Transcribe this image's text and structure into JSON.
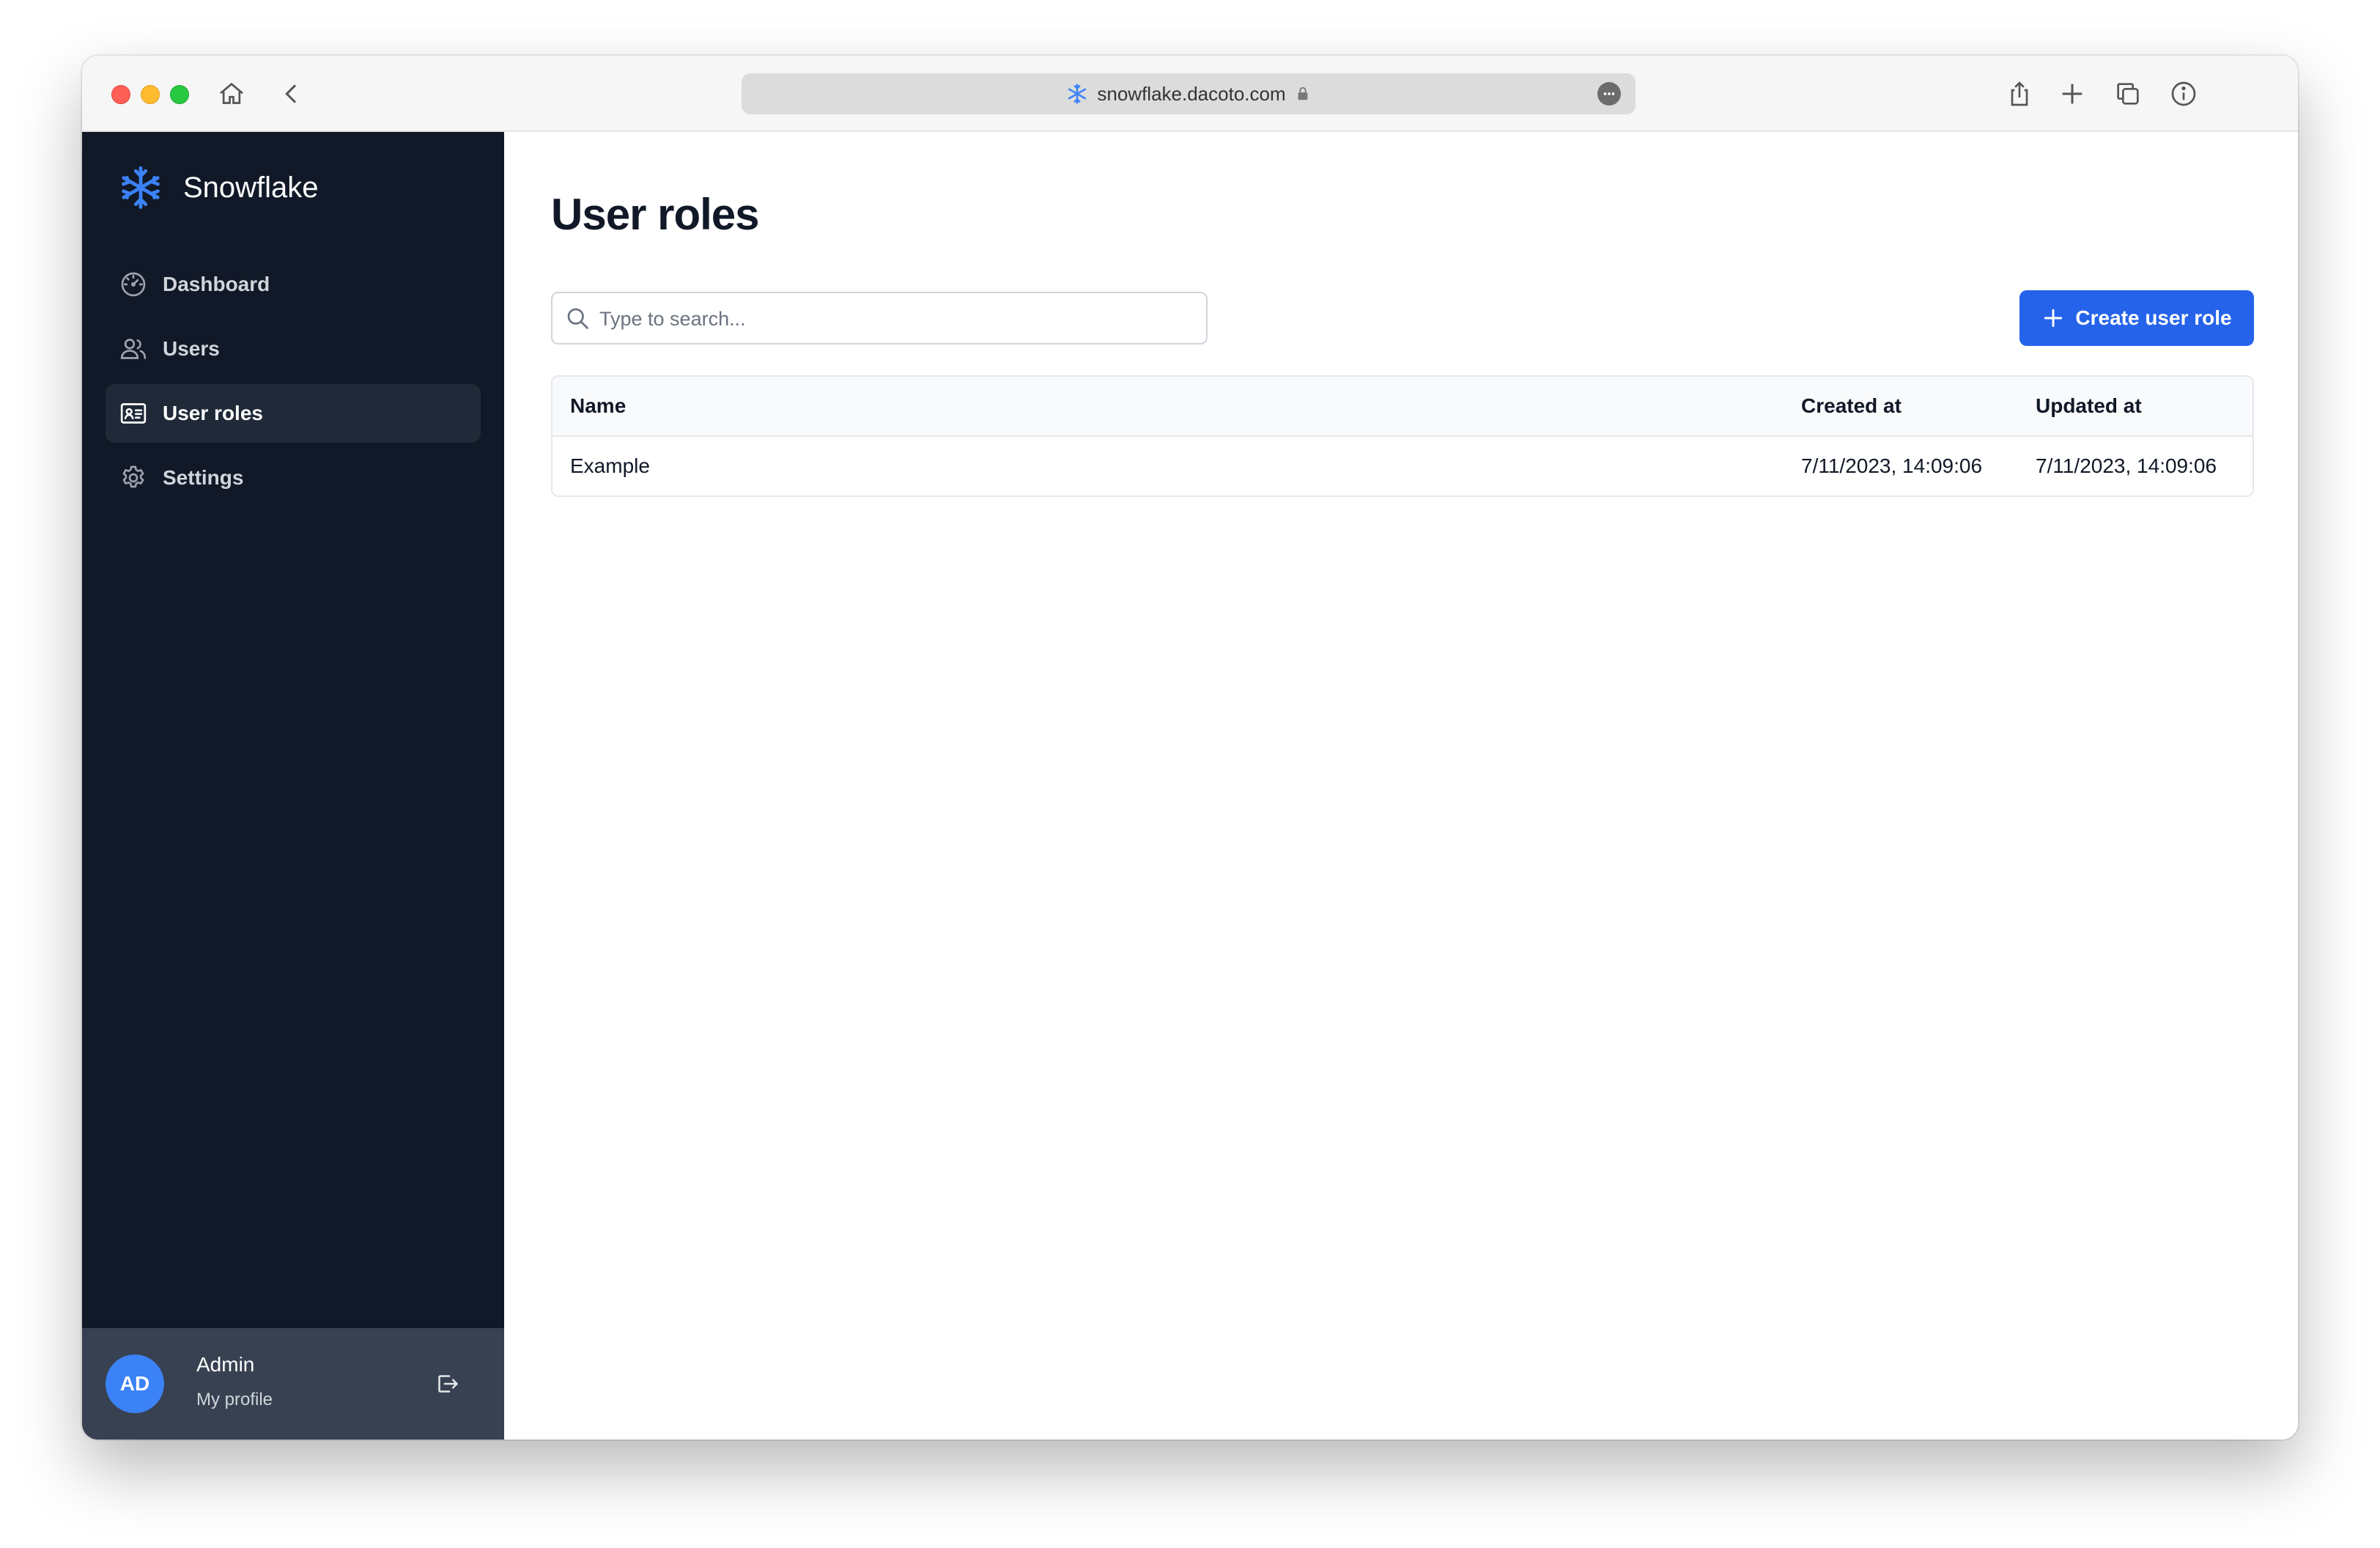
{
  "browser": {
    "url": "snowflake.dacoto.com"
  },
  "app": {
    "name": "Snowflake",
    "accent_color": "#2563eb",
    "sidebar_color": "#111827"
  },
  "sidebar": {
    "items": [
      {
        "label": "Dashboard",
        "icon": "dashboard-icon",
        "active": false
      },
      {
        "label": "Users",
        "icon": "users-icon",
        "active": false
      },
      {
        "label": "User roles",
        "icon": "id-card-icon",
        "active": true
      },
      {
        "label": "Settings",
        "icon": "gear-icon",
        "active": false
      }
    ]
  },
  "profile": {
    "initials": "AD",
    "name": "Admin",
    "subtitle": "My profile"
  },
  "main": {
    "title": "User roles",
    "search_placeholder": "Type to search...",
    "create_button_label": "Create user role",
    "table": {
      "columns": [
        "Name",
        "Created at",
        "Updated at"
      ],
      "rows": [
        {
          "name": "Example",
          "created_at": "7/11/2023, 14:09:06",
          "updated_at": "7/11/2023, 14:09:06"
        }
      ]
    }
  }
}
